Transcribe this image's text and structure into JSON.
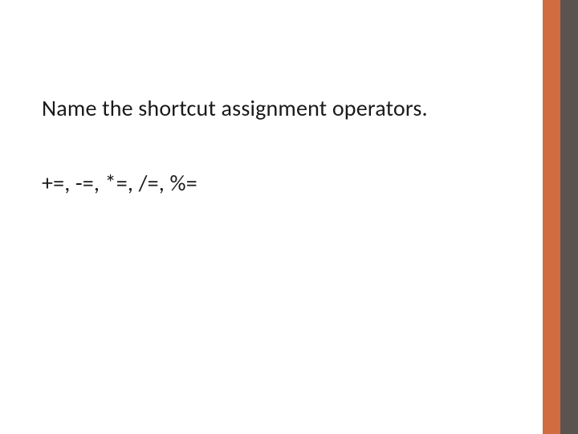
{
  "slide": {
    "title": "Name the shortcut assignment operators.",
    "body": "+=, -=, *=, /=, %="
  }
}
